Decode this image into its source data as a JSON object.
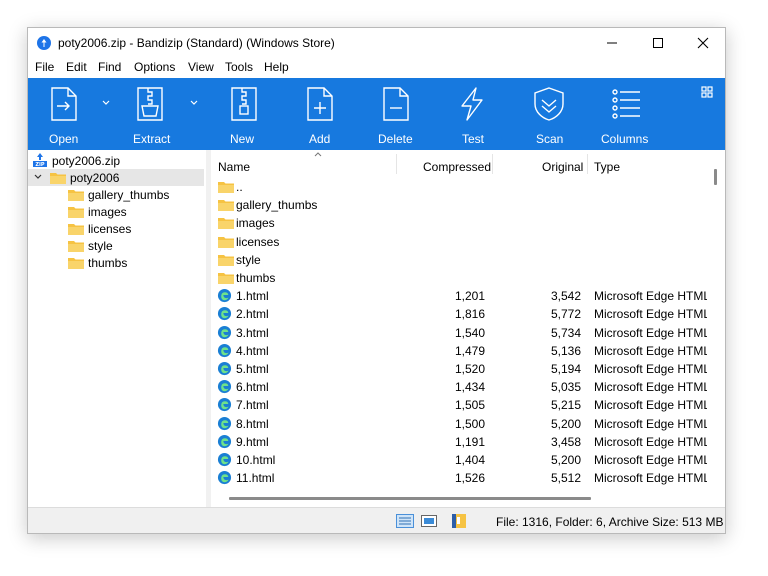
{
  "window": {
    "title": "poty2006.zip - Bandizip (Standard) (Windows Store)"
  },
  "menu": [
    "File",
    "Edit",
    "Find",
    "Options",
    "View",
    "Tools",
    "Help"
  ],
  "toolbar": {
    "open": "Open",
    "extract": "Extract",
    "new": "New",
    "add": "Add",
    "delete": "Delete",
    "test": "Test",
    "scan": "Scan",
    "columns": "Columns"
  },
  "tree": {
    "archive": "poty2006.zip",
    "root": "poty2006",
    "children": [
      "gallery_thumbs",
      "images",
      "licenses",
      "style",
      "thumbs"
    ]
  },
  "columns": {
    "name": "Name",
    "compressed": "Compressed",
    "original": "Original",
    "type": "Type"
  },
  "folders": [
    "..",
    "gallery_thumbs",
    "images",
    "licenses",
    "style",
    "thumbs"
  ],
  "files": [
    {
      "name": "1.html",
      "compressed": "1,201",
      "original": "3,542",
      "type": "Microsoft Edge HTML D..."
    },
    {
      "name": "2.html",
      "compressed": "1,816",
      "original": "5,772",
      "type": "Microsoft Edge HTML D..."
    },
    {
      "name": "3.html",
      "compressed": "1,540",
      "original": "5,734",
      "type": "Microsoft Edge HTML D..."
    },
    {
      "name": "4.html",
      "compressed": "1,479",
      "original": "5,136",
      "type": "Microsoft Edge HTML D..."
    },
    {
      "name": "5.html",
      "compressed": "1,520",
      "original": "5,194",
      "type": "Microsoft Edge HTML D..."
    },
    {
      "name": "6.html",
      "compressed": "1,434",
      "original": "5,035",
      "type": "Microsoft Edge HTML D..."
    },
    {
      "name": "7.html",
      "compressed": "1,505",
      "original": "5,215",
      "type": "Microsoft Edge HTML D..."
    },
    {
      "name": "8.html",
      "compressed": "1,500",
      "original": "5,200",
      "type": "Microsoft Edge HTML D..."
    },
    {
      "name": "9.html",
      "compressed": "1,191",
      "original": "3,458",
      "type": "Microsoft Edge HTML D..."
    },
    {
      "name": "10.html",
      "compressed": "1,404",
      "original": "5,200",
      "type": "Microsoft Edge HTML D..."
    },
    {
      "name": "11.html",
      "compressed": "1,526",
      "original": "5,512",
      "type": "Microsoft Edge HTML D..."
    }
  ],
  "status": {
    "summary": "File: 1316, Folder: 6, Archive Size: 513 MB"
  },
  "colors": {
    "toolbar": "#1779df",
    "folder": "#f6c343",
    "edge": "#1a7fd4"
  },
  "icons": {
    "folder": "folder-icon",
    "html": "edge-html-icon",
    "zip": "zip-archive-icon"
  }
}
